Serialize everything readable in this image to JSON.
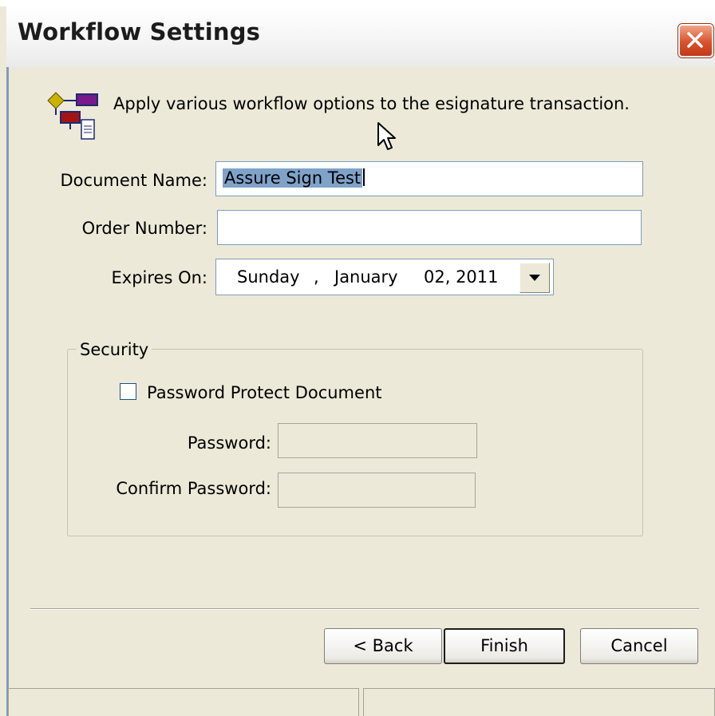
{
  "window": {
    "title": "Workflow Settings"
  },
  "header": {
    "description": "Apply various workflow options to the esignature transaction."
  },
  "form": {
    "document_name_label": "Document Name:",
    "document_name_value": "Assure Sign Test",
    "order_number_label": "Order Number:",
    "order_number_value": "",
    "expires_on_label": "Expires On:",
    "expires_on": {
      "weekday": "Sunday",
      "separator": ",",
      "month": "January",
      "day_year": "02, 2011"
    }
  },
  "security": {
    "group_label": "Security",
    "password_protect_label": "Password Protect Document",
    "password_protect_checked": false,
    "password_label": "Password:",
    "confirm_password_label": "Confirm Password:"
  },
  "buttons": {
    "back": "< Back",
    "finish": "Finish",
    "cancel": "Cancel"
  },
  "colors": {
    "close_button": "#d9532c",
    "selection": "#7fa2c9",
    "dialog_bg": "#ece9d8"
  }
}
